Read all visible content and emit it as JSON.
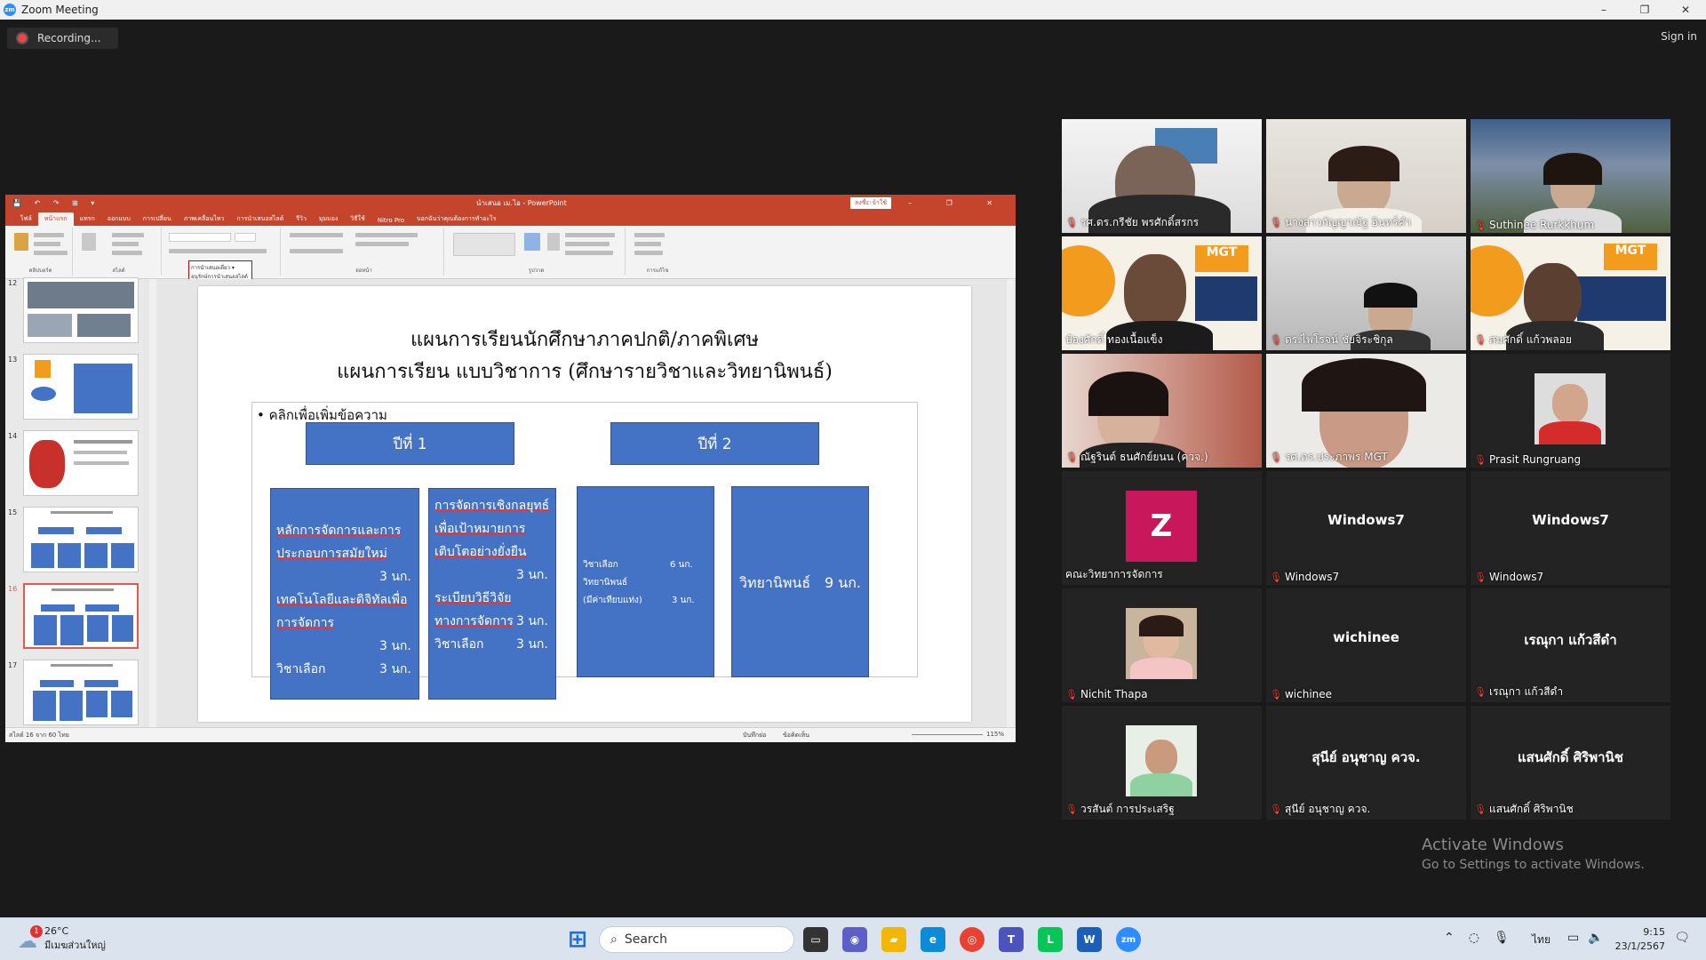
{
  "window": {
    "title": "Zoom Meeting",
    "minimize": "–",
    "maximize": "❐",
    "close": "✕"
  },
  "recording": {
    "label": "Recording..."
  },
  "signin": "Sign in",
  "ppt": {
    "titlebar": {
      "quick_access": "💾 ↶ ↷ ⊞ ▾",
      "doc_title": "นำเสนอ เม.ไอ  -  PowerPoint",
      "share": "ลงชื่อเข้าใช้",
      "controls": "⊞ – ❐ ✕"
    },
    "tabs": [
      "ไฟล์",
      "หน้าแรก",
      "แทรก",
      "ออกแบบ",
      "การเปลี่ยน",
      "ภาพเคลื่อนไหว",
      "การนำเสนอสไลด์",
      "รีวิว",
      "มุมมอง",
      "วิธีใช้",
      "Nitro Pro",
      "บอกฉันว่าคุณต้องการทำอะไร"
    ],
    "ribbon_groups": [
      "คลิปบอร์ด",
      "สไลด์",
      "ฟอนต์",
      "ย่อหน้า",
      "รูปวาด",
      "การแก้ไข"
    ],
    "tooltip": {
      "line1": "การนำเสนอเดี่ยว ▾",
      "line2": "อนุรักษ์การนำเสนอสไลด์"
    },
    "thumb_numbers": [
      "12",
      "13",
      "14",
      "15",
      "16",
      "17"
    ],
    "slide": {
      "title1": "แผนการเรียนนักศึกษาภาคปกติ/ภาคพิเศษ",
      "title2": "แผนการเรียน แบบวิชาการ (ศึกษารายวิชาและวิทยานิพนธ์)",
      "bullet": "คลิกเพื่อเพิ่มข้อความ",
      "year1": "ปีที่ 1",
      "year2": "ปีที่ 2",
      "col1": {
        "l1": "หลักการจัดการและการ",
        "l2": "ประกอบการสมัยใหม่",
        "l3": "3 นก.",
        "l4": "เทคโนโลยีและดิจิทัลเพื่อ",
        "l5": "การจัดการ",
        "l6": "3 นก.",
        "l7": "วิชาเลือก",
        "l8": "3 นก."
      },
      "col2": {
        "l1": "การจัดการเชิงกลยุทธ์",
        "l2": "เพื่อเป้าหมายการ",
        "l3": "เติบโตอย่างยั่งยืน",
        "l4": "3 นก.",
        "l5": "ระเบียบวิธีวิจัย",
        "l6": "ทางการจัดการ",
        "l7": "3 นก.",
        "l8": "วิชาเลือก",
        "l9": "3 นก."
      },
      "col3": {
        "l1": "วิชาเลือก",
        "l1v": "6 นก.",
        "l2": "วิทยานิพนธ์",
        "l3": "(มีค่าเทียบแท่ง)",
        "l3v": "3 นก."
      },
      "col4": {
        "l1": "วิทยานิพนธ์",
        "l1v": "9 นก."
      }
    },
    "status": {
      "left": "สไลด์ 16 จาก 60   ไทย",
      "notes": "บันทึกย่อ",
      "comments": "ข้อคิดเห็น",
      "zoom": "115%"
    }
  },
  "participants": [
    {
      "name": "รศ.ดร.กรีชัย พรศักดิ์สรกร",
      "muted": true,
      "video": true
    },
    {
      "name": "นางสาวกัญญาณัฐ อินทร์คำ",
      "muted": true,
      "video": true
    },
    {
      "name": "Suthinee Rurkkhum",
      "muted": true,
      "video": true
    },
    {
      "name": "ป๋องศักดิ์  ทองเนื้อแข็ง",
      "muted": false,
      "video": true,
      "active": true
    },
    {
      "name": "ดร.ไพโรจน์ ชัยจิระชิกุล",
      "muted": true,
      "video": true
    },
    {
      "name": "สมศักดิ์ แก้วพลอย",
      "muted": true,
      "video": true
    },
    {
      "name": "ณัฐรินต์ ธนศักย์ยนน (ควจ.)",
      "muted": true,
      "video": true
    },
    {
      "name": "รศ.ดร.ประภาพร MGT",
      "muted": true,
      "video": true
    },
    {
      "name": "Prasit Rungruang",
      "muted": true,
      "video": true
    },
    {
      "name": "คณะวิทยาการจัดการ",
      "muted": false,
      "avatar_letter": "Z"
    },
    {
      "name": "Windows7",
      "muted": true,
      "display": "Windows7"
    },
    {
      "name": "Windows7",
      "muted": true,
      "display": "Windows7"
    },
    {
      "name": "Nichit Thapa",
      "muted": true,
      "photo": true
    },
    {
      "name": "wichinee",
      "muted": true,
      "display": "wichinee"
    },
    {
      "name": "เรณุกา แก้วสีดำ",
      "muted": true,
      "display": "เรณุกา แก้วสีดำ"
    },
    {
      "name": "วรสันต์ การประเสริฐ",
      "muted": true,
      "photo": true
    },
    {
      "name": "สุนีย์ อนุชาญ ควจ.",
      "muted": true,
      "display": "สุนีย์ อนุชาญ ควจ."
    },
    {
      "name": "แสนศักดิ์ ศิริพานิช",
      "muted": true,
      "display": "แสนศักดิ์ ศิริพานิช"
    }
  ],
  "activate": {
    "line1": "Activate Windows",
    "line2": "Go to Settings to activate Windows."
  },
  "taskbar": {
    "weather_temp": "26°C",
    "weather_desc": "มีเมฆส่วนใหญ่",
    "weather_badge": "1",
    "search_placeholder": "Search",
    "lang": "ไทย",
    "time": "9:15",
    "date": "23/1/2567",
    "icons": [
      {
        "name": "start-icon",
        "glyph": "⊞",
        "color": "#1e6fd9"
      },
      {
        "name": "taskview-icon",
        "glyph": "▭",
        "color": "#333"
      },
      {
        "name": "meet-icon",
        "glyph": "◉",
        "color": "#5b5fc7"
      },
      {
        "name": "folder-icon",
        "glyph": "▰",
        "color": "#f2b705"
      },
      {
        "name": "edge-icon",
        "glyph": "e",
        "color": "#0c8bd9"
      },
      {
        "name": "chrome-icon",
        "glyph": "◎",
        "color": "#e94235"
      },
      {
        "name": "teams-icon",
        "glyph": "T",
        "color": "#4b53bc"
      },
      {
        "name": "line-icon",
        "glyph": "L",
        "color": "#06c755"
      },
      {
        "name": "word-icon",
        "glyph": "W",
        "color": "#1b5fb8"
      },
      {
        "name": "zoom-icon",
        "glyph": "zm",
        "color": "#2d8cff"
      }
    ]
  },
  "colors": {
    "accent_ppt": "#c4452b",
    "slide_blue": "#4472c4",
    "active_speaker": "#e7ef36",
    "zoom_blue": "#2d8cff"
  }
}
